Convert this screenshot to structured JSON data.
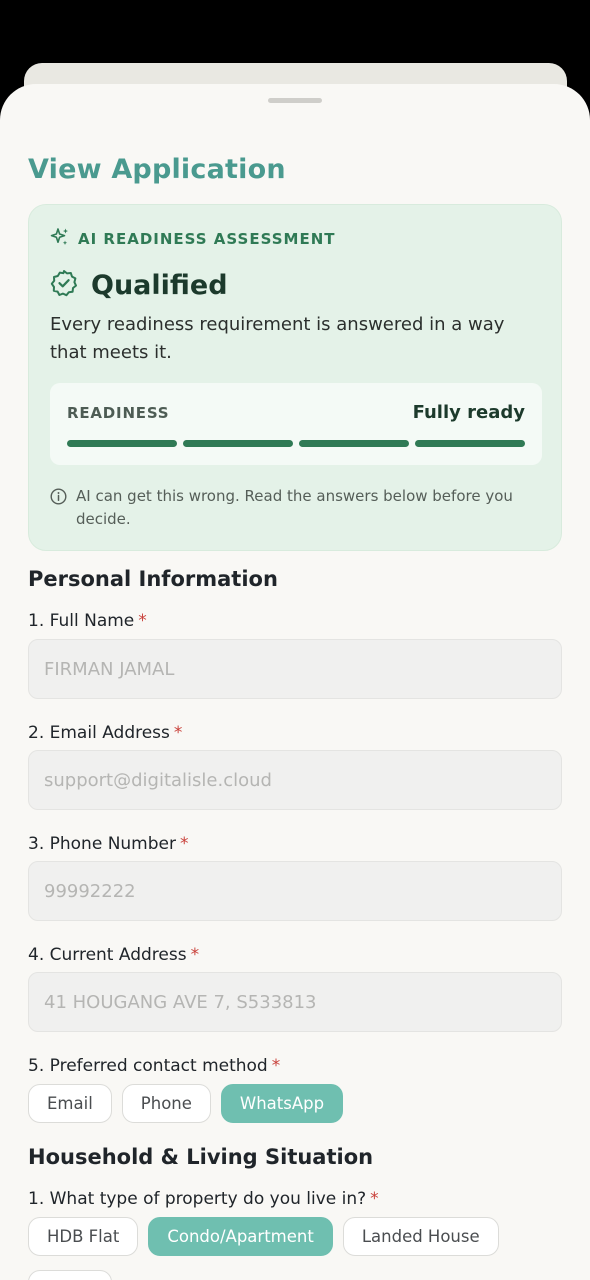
{
  "page": {
    "title": "View Application"
  },
  "ai_assessment": {
    "header": "AI READINESS ASSESSMENT",
    "status": "Qualified",
    "description": "Every readiness requirement is answered in a way that meets it.",
    "readiness_label": "READINESS",
    "readiness_value": "Fully ready",
    "readiness_fraction": 1.0,
    "disclaimer": "AI can get this wrong. Read the answers below before you decide.",
    "accent_color": "#2f7a55"
  },
  "personal": {
    "section_title": "Personal Information",
    "full_name": {
      "label": "1. Full Name",
      "value": "FIRMAN JAMAL"
    },
    "email": {
      "label": "2. Email Address",
      "value": "support@digitalisle.cloud"
    },
    "phone": {
      "label": "3. Phone Number",
      "value": "99992222"
    },
    "address": {
      "label": "4. Current Address",
      "value": "41 HOUGANG AVE 7, S533813"
    },
    "contact": {
      "label": "5. Preferred contact method",
      "options": [
        "Email",
        "Phone",
        "WhatsApp"
      ],
      "selected": "WhatsApp"
    }
  },
  "household": {
    "section_title": "Household & Living Situation",
    "property": {
      "label": "1. What type of property do you live in?",
      "options": [
        "HDB Flat",
        "Condo/Apartment",
        "Landed House"
      ],
      "selected": "Condo/Apartment"
    }
  },
  "required_marker": "*",
  "colors": {
    "brand": "#4a9a8f",
    "selected_pill": "#6fbfb0",
    "required": "#c9413a"
  }
}
